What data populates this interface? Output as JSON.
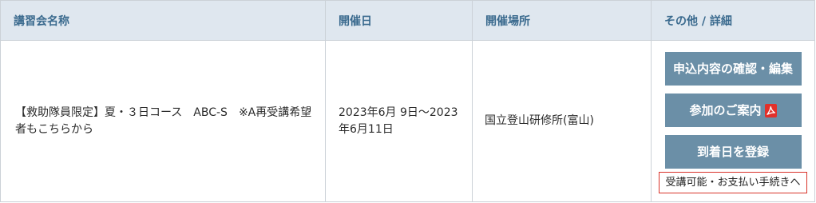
{
  "table": {
    "headers": {
      "name": "講習会名称",
      "date": "開催日",
      "location": "開催場所",
      "details": "その他 / 詳細"
    },
    "rows": [
      {
        "name": "【救助隊員限定】夏・３日コース　ABC-S　※A再受講希望者もこちらから",
        "date": "2023年6月 9日〜2023年6月11日",
        "location": "国立登山研修所(富山)",
        "actions": {
          "edit_button": "申込内容の確認・編集",
          "guide_button": "参加のご案内",
          "guide_icon": "pdf-icon",
          "arrival_button": "到着日を登録",
          "payment_link": "受講可能・お支払い手続きへ"
        }
      }
    ]
  },
  "colors": {
    "header_background": "#dfe7ef",
    "header_text": "#3a6a8e",
    "body_text": "#2b2b2b",
    "border": "#cbd1d7",
    "button_background": "#6b8fa7",
    "button_text": "#ffffff",
    "pdf_icon": "#e2302a",
    "payment_link_border": "#d9342b"
  }
}
